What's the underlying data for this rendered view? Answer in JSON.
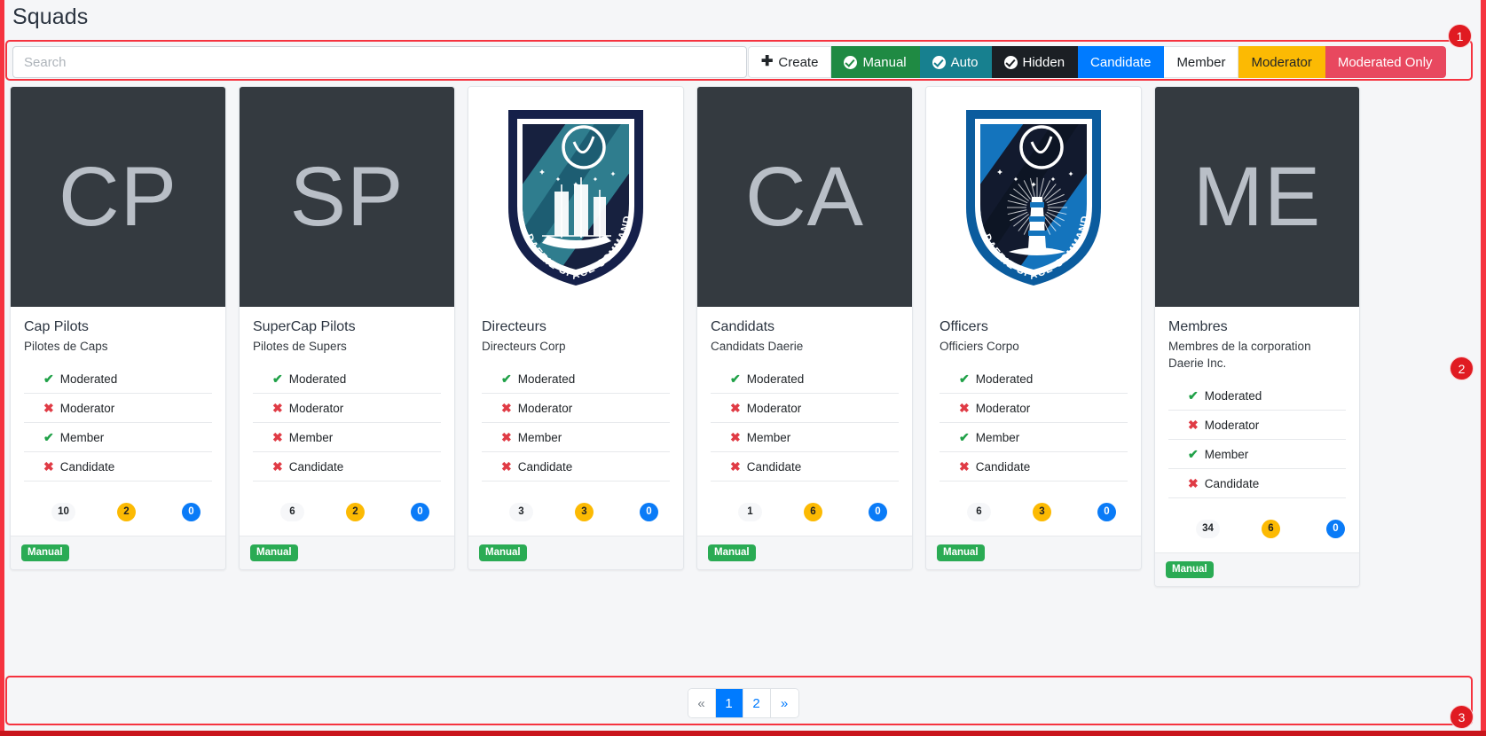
{
  "page": {
    "title": "Squads"
  },
  "search": {
    "placeholder": "Search",
    "value": ""
  },
  "toolbar": {
    "buttons": [
      {
        "label": "Create",
        "style": "light",
        "icon": "plus-icon"
      },
      {
        "label": "Manual",
        "style": "green",
        "icon": "check-circle-icon"
      },
      {
        "label": "Auto",
        "style": "teal",
        "icon": "check-circle-icon"
      },
      {
        "label": "Hidden",
        "style": "dark",
        "icon": "check-circle-icon"
      },
      {
        "label": "Candidate",
        "style": "blue",
        "icon": ""
      },
      {
        "label": "Member",
        "style": "light",
        "icon": ""
      },
      {
        "label": "Moderator",
        "style": "amber",
        "icon": ""
      },
      {
        "label": "Moderated Only",
        "style": "red",
        "icon": ""
      }
    ]
  },
  "cards": [
    {
      "initials": "CP",
      "media_type": "initials",
      "title": "Cap Pilots",
      "subtitle": "Pilotes de Caps",
      "flags": [
        {
          "label": "Moderated",
          "state": "yes"
        },
        {
          "label": "Moderator",
          "state": "no"
        },
        {
          "label": "Member",
          "state": "yes"
        },
        {
          "label": "Candidate",
          "state": "no"
        }
      ],
      "counts": {
        "members": "10",
        "moderators": "2",
        "candidates": "0"
      },
      "badge": "Manual"
    },
    {
      "initials": "SP",
      "media_type": "initials",
      "title": "SuperCap Pilots",
      "subtitle": "Pilotes de Supers",
      "flags": [
        {
          "label": "Moderated",
          "state": "yes"
        },
        {
          "label": "Moderator",
          "state": "no"
        },
        {
          "label": "Member",
          "state": "no"
        },
        {
          "label": "Candidate",
          "state": "no"
        }
      ],
      "counts": {
        "members": "6",
        "moderators": "2",
        "candidates": "0"
      },
      "badge": "Manual"
    },
    {
      "initials": "",
      "media_type": "emblem-dark",
      "emblem_text": "DAERIE SPACE COMMAND",
      "title": "Directeurs",
      "subtitle": "Directeurs Corp",
      "flags": [
        {
          "label": "Moderated",
          "state": "yes"
        },
        {
          "label": "Moderator",
          "state": "no"
        },
        {
          "label": "Member",
          "state": "no"
        },
        {
          "label": "Candidate",
          "state": "no"
        }
      ],
      "counts": {
        "members": "3",
        "moderators": "3",
        "candidates": "0"
      },
      "badge": "Manual"
    },
    {
      "initials": "CA",
      "media_type": "initials",
      "title": "Candidats",
      "subtitle": "Candidats Daerie",
      "flags": [
        {
          "label": "Moderated",
          "state": "yes"
        },
        {
          "label": "Moderator",
          "state": "no"
        },
        {
          "label": "Member",
          "state": "no"
        },
        {
          "label": "Candidate",
          "state": "no"
        }
      ],
      "counts": {
        "members": "1",
        "moderators": "6",
        "candidates": "0"
      },
      "badge": "Manual"
    },
    {
      "initials": "",
      "media_type": "emblem-blue",
      "emblem_text": "DAERIE SPACE COMMAND",
      "title": "Officers",
      "subtitle": "Officiers Corpo",
      "flags": [
        {
          "label": "Moderated",
          "state": "yes"
        },
        {
          "label": "Moderator",
          "state": "no"
        },
        {
          "label": "Member",
          "state": "yes"
        },
        {
          "label": "Candidate",
          "state": "no"
        }
      ],
      "counts": {
        "members": "6",
        "moderators": "3",
        "candidates": "0"
      },
      "badge": "Manual"
    },
    {
      "initials": "ME",
      "media_type": "initials",
      "title": "Membres",
      "subtitle": "Membres de la corporation Daerie Inc.",
      "flags": [
        {
          "label": "Moderated",
          "state": "yes"
        },
        {
          "label": "Moderator",
          "state": "no"
        },
        {
          "label": "Member",
          "state": "yes"
        },
        {
          "label": "Candidate",
          "state": "no"
        }
      ],
      "counts": {
        "members": "34",
        "moderators": "6",
        "candidates": "0"
      },
      "badge": "Manual"
    }
  ],
  "pagination": {
    "prev": "«",
    "pages": [
      {
        "label": "1",
        "active": true
      },
      {
        "label": "2",
        "active": false
      }
    ],
    "next": "»"
  },
  "annotations": [
    {
      "number": "1"
    },
    {
      "number": "2"
    },
    {
      "number": "3"
    }
  ],
  "colors": {
    "accent_blue": "#007bff",
    "green": "#1f8a43",
    "teal": "#17808f",
    "dark": "#1b1f24",
    "amber": "#fcba03",
    "red": "#e8485f",
    "annotation_red": "#f5333f",
    "media_dark": "#343a40"
  },
  "marks": {
    "yes": "✔",
    "no": "✖"
  }
}
